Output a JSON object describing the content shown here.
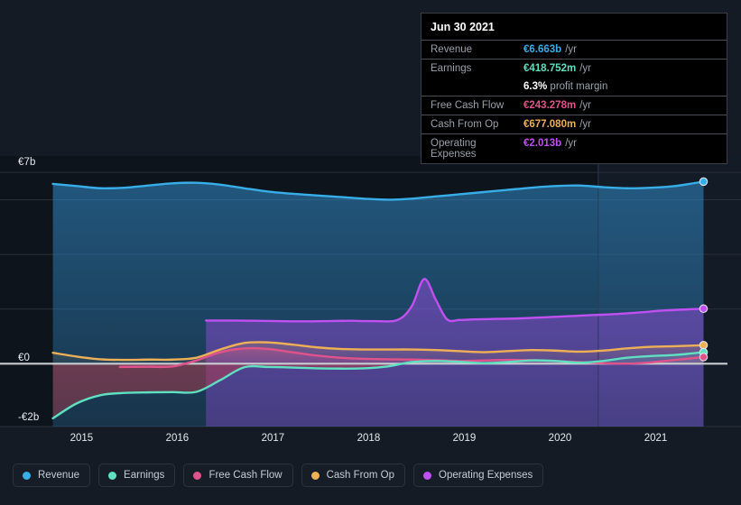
{
  "colors": {
    "background": "#141b24",
    "plot_background": "#0e141c",
    "gridline": "#2a313c",
    "zero_line": "#c9ccd1",
    "revenue": "#37aee8",
    "earnings": "#5fe0c0",
    "free_cash_flow": "#e0538a",
    "cash_from_op": "#eeb057",
    "operating_expenses": "#b martin"
  },
  "tooltip": {
    "date": "Jun 30 2021",
    "rows": [
      {
        "label": "Revenue",
        "value": "€6.663b",
        "unit": "/yr",
        "color": "#37aee8"
      },
      {
        "label": "Earnings",
        "value": "€418.752m",
        "unit": "/yr",
        "color": "#5fe0c0"
      },
      {
        "label": "Free Cash Flow",
        "value": "€243.278m",
        "unit": "/yr",
        "color": "#e0538a"
      },
      {
        "label": "Cash From Op",
        "value": "€677.080m",
        "unit": "/yr",
        "color": "#eeb057"
      },
      {
        "label": "Operating Expenses",
        "value": "€2.013b",
        "unit": "/yr",
        "color": "#c050f0"
      }
    ],
    "margin_value": "6.3%",
    "margin_text": "profit margin"
  },
  "legend": [
    {
      "label": "Revenue",
      "color": "#37aee8"
    },
    {
      "label": "Earnings",
      "color": "#5fe0c0"
    },
    {
      "label": "Free Cash Flow",
      "color": "#e0538a"
    },
    {
      "label": "Cash From Op",
      "color": "#eeb057"
    },
    {
      "label": "Operating Expenses",
      "color": "#c050f0"
    }
  ],
  "chart_data": {
    "type": "area",
    "title": "",
    "xlabel": "",
    "ylabel": "",
    "grid": true,
    "legend_position": "bottom",
    "currency": "EUR",
    "y_ticks": [
      "€7b",
      "€0",
      "-€2b"
    ],
    "y_tick_values": [
      7,
      0,
      -2
    ],
    "ylim": [
      -2.3,
      7.6
    ],
    "x_ticks": [
      "2015",
      "2016",
      "2017",
      "2018",
      "2019",
      "2020",
      "2021"
    ],
    "xlim": [
      "2014.6",
      "2021.75"
    ],
    "forecast_divider_x": "2020.4",
    "series": [
      {
        "name": "Revenue",
        "color": "#37aee8",
        "unit": "b",
        "x": [
          2014.7,
          2014.95,
          2015.2,
          2015.45,
          2015.7,
          2015.95,
          2016.2,
          2016.45,
          2016.7,
          2016.95,
          2017.2,
          2017.45,
          2017.7,
          2017.95,
          2018.2,
          2018.45,
          2018.7,
          2018.95,
          2019.2,
          2019.45,
          2019.7,
          2019.95,
          2020.2,
          2020.45,
          2020.7,
          2020.95,
          2021.2,
          2021.5
        ],
        "values": [
          6.58,
          6.5,
          6.42,
          6.44,
          6.52,
          6.6,
          6.62,
          6.55,
          6.42,
          6.3,
          6.22,
          6.16,
          6.1,
          6.04,
          6.0,
          6.04,
          6.12,
          6.2,
          6.28,
          6.36,
          6.44,
          6.5,
          6.52,
          6.46,
          6.42,
          6.44,
          6.5,
          6.663
        ]
      },
      {
        "name": "Earnings",
        "color": "#5fe0c0",
        "unit": "b",
        "x": [
          2014.7,
          2014.95,
          2015.2,
          2015.45,
          2015.7,
          2015.95,
          2016.2,
          2016.45,
          2016.7,
          2016.95,
          2017.2,
          2017.45,
          2017.7,
          2017.95,
          2018.2,
          2018.45,
          2018.7,
          2018.95,
          2019.2,
          2019.45,
          2019.7,
          2019.95,
          2020.2,
          2020.45,
          2020.7,
          2020.95,
          2021.2,
          2021.5
        ],
        "values": [
          -2.0,
          -1.45,
          -1.15,
          -1.07,
          -1.05,
          -1.04,
          -1.03,
          -0.6,
          -0.13,
          -0.12,
          -0.14,
          -0.17,
          -0.18,
          -0.17,
          -0.1,
          0.06,
          0.1,
          0.07,
          0.02,
          0.06,
          0.12,
          0.1,
          0.04,
          0.1,
          0.22,
          0.28,
          0.32,
          0.418752
        ]
      },
      {
        "name": "Free Cash Flow",
        "color": "#e0538a",
        "unit": "b",
        "x": [
          2015.4,
          2015.7,
          2015.95,
          2016.2,
          2016.45,
          2016.7,
          2016.95,
          2017.2,
          2017.45,
          2017.7,
          2017.95,
          2018.2,
          2018.45,
          2018.7,
          2018.95,
          2019.2,
          2019.45,
          2019.7,
          2019.95,
          2020.2,
          2020.45,
          2020.7,
          2020.95,
          2021.2,
          2021.5
        ],
        "values": [
          -0.12,
          -0.11,
          -0.1,
          0.12,
          0.42,
          0.56,
          0.54,
          0.42,
          0.3,
          0.22,
          0.18,
          0.16,
          0.15,
          0.13,
          0.1,
          0.12,
          0.14,
          0.13,
          0.1,
          0.06,
          0.02,
          0.0,
          0.05,
          0.14,
          0.243278
        ]
      },
      {
        "name": "Cash From Op",
        "color": "#eeb057",
        "unit": "b",
        "x": [
          2014.7,
          2014.95,
          2015.2,
          2015.45,
          2015.7,
          2015.95,
          2016.2,
          2016.45,
          2016.7,
          2016.95,
          2017.2,
          2017.45,
          2017.7,
          2017.95,
          2018.2,
          2018.45,
          2018.7,
          2018.95,
          2019.2,
          2019.45,
          2019.7,
          2019.95,
          2020.2,
          2020.45,
          2020.7,
          2020.95,
          2021.2,
          2021.5
        ],
        "values": [
          0.4,
          0.26,
          0.16,
          0.14,
          0.15,
          0.15,
          0.22,
          0.52,
          0.76,
          0.78,
          0.7,
          0.6,
          0.54,
          0.52,
          0.52,
          0.52,
          0.5,
          0.46,
          0.42,
          0.46,
          0.5,
          0.48,
          0.44,
          0.48,
          0.56,
          0.62,
          0.64,
          0.67708
        ]
      },
      {
        "name": "Operating Expenses",
        "color": "#c050f0",
        "unit": "b",
        "x": [
          2016.3,
          2016.55,
          2016.8,
          2017.05,
          2017.3,
          2017.55,
          2017.8,
          2018.05,
          2018.3,
          2018.45,
          2018.58,
          2018.7,
          2018.82,
          2018.95,
          2019.1,
          2019.35,
          2019.6,
          2019.85,
          2020.1,
          2020.35,
          2020.6,
          2020.85,
          2021.1,
          2021.5
        ],
        "values": [
          1.58,
          1.58,
          1.57,
          1.56,
          1.55,
          1.56,
          1.57,
          1.56,
          1.6,
          2.1,
          3.1,
          2.35,
          1.62,
          1.6,
          1.62,
          1.64,
          1.66,
          1.7,
          1.74,
          1.78,
          1.82,
          1.88,
          1.95,
          2.013
        ]
      }
    ]
  }
}
